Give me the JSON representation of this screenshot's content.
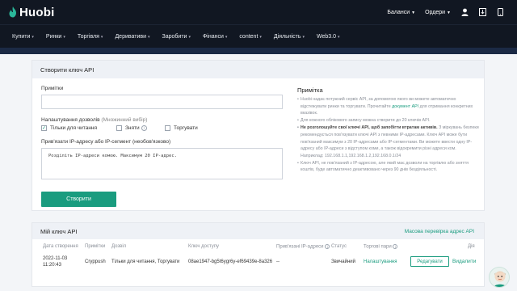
{
  "brand": {
    "name": "Huobi",
    "accent": "#1a9c7f",
    "header_bg": "#111722"
  },
  "top_right": {
    "balances": "Баланси",
    "orders": "Ордери",
    "icons": [
      "user-icon",
      "download-icon",
      "phone-icon"
    ]
  },
  "nav": [
    "Купити",
    "Ринки",
    "Торгівля",
    "Деривативи",
    "Заробити",
    "Фінанси",
    "content",
    "Діяльність",
    "Web3.0"
  ],
  "create_card": {
    "title": "Створити ключ API",
    "notes_label": "Примітки",
    "permissions_label": "Налаштування дозволів",
    "permissions_hint": "(Множинний вибір)",
    "perm_read": "Тільки для читання",
    "perm_withdraw": "Зняти",
    "perm_trade": "Торгувати",
    "ip_label": "Прив'язати IP-адресу або IP-сегмент (необов'язково)",
    "ip_placeholder": "Розділіть IP-адреси комою. Максимум 20 IP-адрес.",
    "create_button": "Створити",
    "remarks_title": "Примітка",
    "remarks": {
      "r1_pre": "Huobi надає потужний сервіс API, за допомогою якого ви можете автоматично відстежувати ринки та торгувати. Прочитайте ",
      "r1_link": "документ API",
      "r1_post": " для отримання конкретних вказівок.",
      "r2": "Для кожного облікового запису можна створити до 20 ключів API.",
      "r3_bold": "Не розголошуйте свої ключі API, щоб запобігти втратам активів.",
      "r3_rest": " З міркувань безпеки рекомендується пов'язувати ключі API з певними IP-адресами. Ключ API може бути пов'язаний максимум з 20 IP-адресами або IP-сегментами. Ви можете ввести одну IP-адресу або IP-адреси з відступом коми, а також відокремити різні адреси ком. Наприклад: 192.168.1.1,192.168.1.2,192.168.0.1/24",
      "r4": "Ключ API, не пов'язаний з IP-адресою, але який має дозволи на торгівлю або зняття коштів, буде автоматично деактивовано через 90 днів бездіяльності."
    }
  },
  "keys_card": {
    "title": "Мій ключ API",
    "bulk_check": "Масова перевірка адрес API",
    "headers": [
      "Дата створення",
      "Примітки",
      "Дозвіл",
      "Ключ доступу",
      "Прив'язані IP-адреси",
      "Статус",
      "Торгові пари",
      "Дія"
    ],
    "rows": [
      {
        "date": "2022-11-03",
        "time": "11:20:43",
        "note": "Cryppush",
        "permission": "Тільки для читання, Торгувати",
        "access_key": "08ae1947-bg5t6ygr6y-ef69439e-8a326",
        "ips": "--",
        "status": "Звичайний",
        "pairs": "Налаштування",
        "edit": "Редагувати",
        "delete": "Видалити"
      }
    ]
  }
}
